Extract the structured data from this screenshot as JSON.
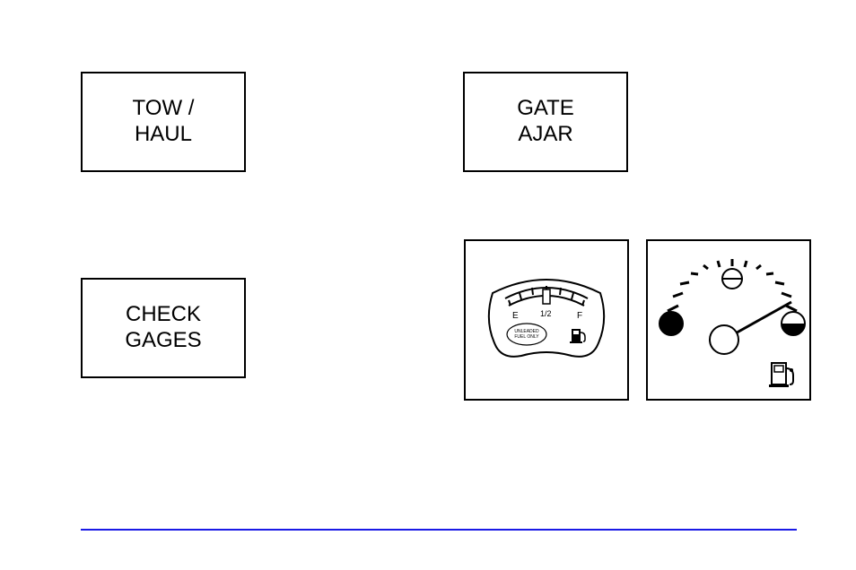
{
  "indicators": {
    "tow_haul": {
      "line1": "TOW /",
      "line2": "HAUL"
    },
    "gate_ajar": {
      "line1": "GATE",
      "line2": "AJAR"
    },
    "check_gages": {
      "line1": "CHECK",
      "line2": "GAGES"
    }
  },
  "gauges": {
    "fuel_small": {
      "empty_label": "E",
      "half_label": "1/2",
      "full_label": "F",
      "text_line1": "UNLEADED",
      "text_line2": "FUEL ONLY"
    }
  }
}
